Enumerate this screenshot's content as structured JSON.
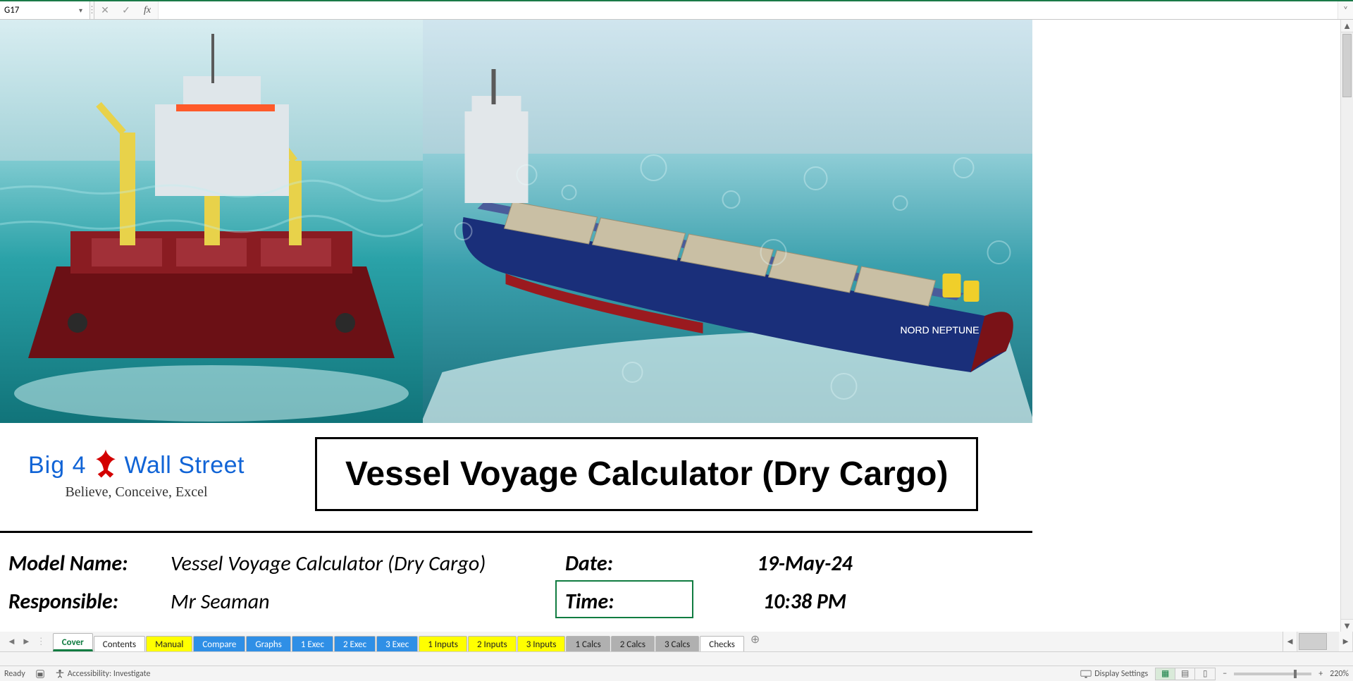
{
  "formula_bar": {
    "cell_ref": "G17",
    "formula": "",
    "cancel_glyph": "✕",
    "enter_glyph": "✓",
    "fx_label": "fx",
    "expand_glyph": "˅",
    "namebox_chevron": "▾",
    "sep_glyph": "⋮"
  },
  "cover": {
    "logo": {
      "text_left": "Big 4",
      "text_right": "Wall Street",
      "tagline": "Believe, Conceive, Excel"
    },
    "title": "Vessel Voyage Calculator (Dry Cargo)",
    "ship_name": "NORD NEPTUNE"
  },
  "meta": {
    "label_model": "Model Name:",
    "value_model": "Vessel Voyage Calculator (Dry Cargo)",
    "label_date": "Date:",
    "value_date": "19-May-24",
    "label_responsible": "Responsible:",
    "value_responsible": "Mr Seaman",
    "label_time": "Time:",
    "value_time": "10:38 PM"
  },
  "tabs": [
    {
      "label": "Cover",
      "color": "active"
    },
    {
      "label": "Contents",
      "color": "white"
    },
    {
      "label": "Manual",
      "color": "yellow"
    },
    {
      "label": "Compare",
      "color": "blue"
    },
    {
      "label": "Graphs",
      "color": "blue"
    },
    {
      "label": "1 Exec",
      "color": "blue"
    },
    {
      "label": "2 Exec",
      "color": "blue"
    },
    {
      "label": "3 Exec",
      "color": "blue"
    },
    {
      "label": "1 Inputs",
      "color": "yellow"
    },
    {
      "label": "2 Inputs",
      "color": "yellow"
    },
    {
      "label": "3 Inputs",
      "color": "yellow"
    },
    {
      "label": "1 Calcs",
      "color": "grey"
    },
    {
      "label": "2 Calcs",
      "color": "grey"
    },
    {
      "label": "3 Calcs",
      "color": "grey"
    },
    {
      "label": "Checks",
      "color": "white"
    }
  ],
  "tab_nav": {
    "first": "|◄",
    "prev": "◄",
    "next": "►",
    "last": "►|",
    "sep": "⋮"
  },
  "status": {
    "ready": "Ready",
    "accessibility": "Accessibility: Investigate",
    "display_settings": "Display Settings",
    "zoom_label": "220%",
    "zoom_minus": "−",
    "zoom_plus": "+"
  }
}
